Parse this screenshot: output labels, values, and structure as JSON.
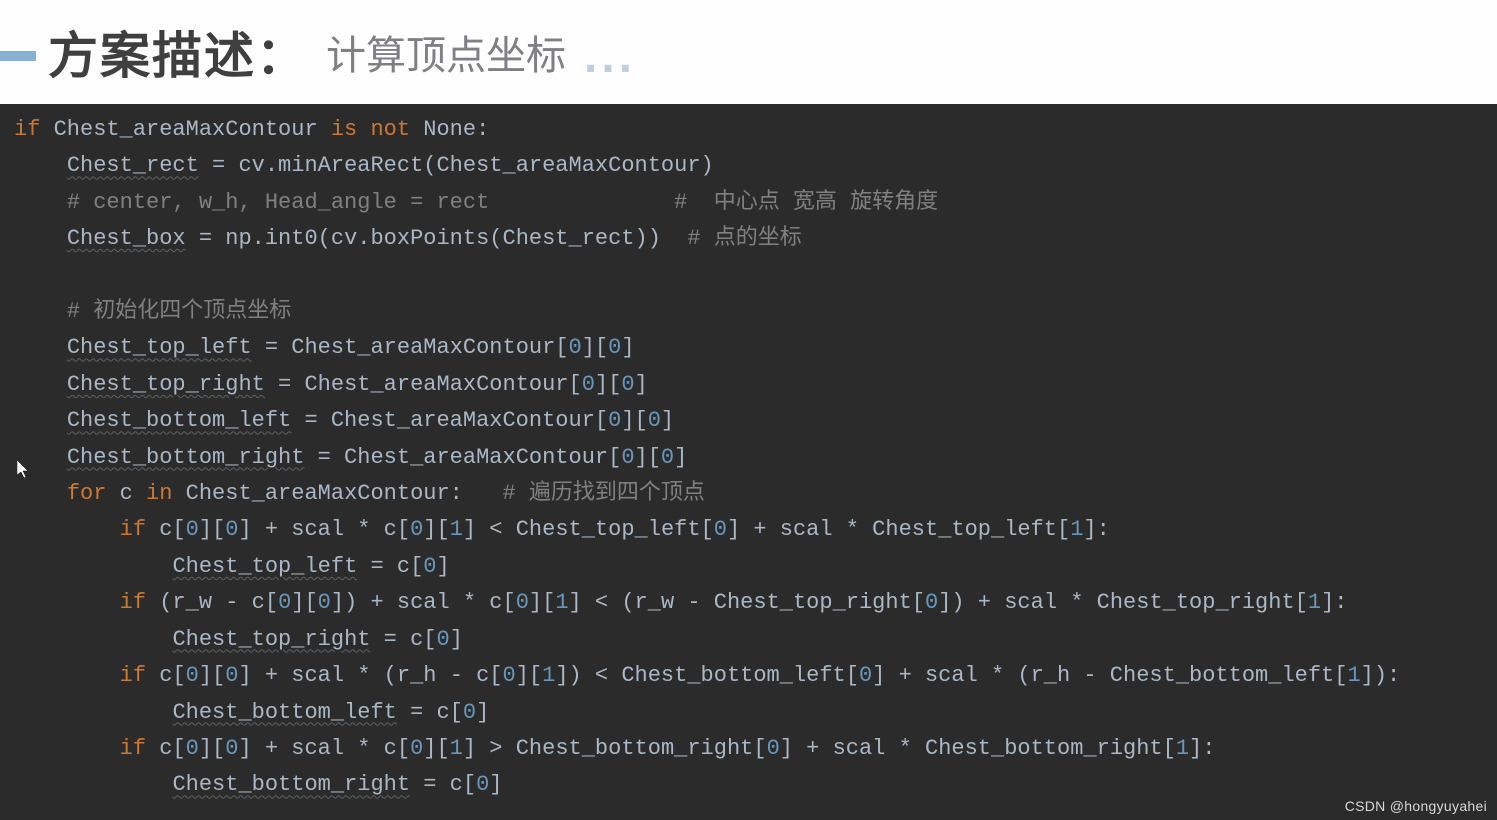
{
  "header": {
    "title_main": "方案描述：",
    "title_sub": "计算顶点坐标",
    "dots": "..."
  },
  "code": {
    "l1_kw1": "if",
    "l1_mid": " Chest_areaMaxContour ",
    "l1_kw2": "is not",
    "l1_end": " None:",
    "l2_var": "Chest_rect",
    "l2_rest": " = cv.minAreaRect(Chest_areaMaxContour)",
    "l3_cmt1": "# center, w_h, Head_angle = rect",
    "l3_cmt2": "#  中心点 宽高 旋转角度",
    "l4_var": "Chest_box",
    "l4_rest": " = np.int0(cv.boxPoints(Chest_rect))  ",
    "l4_cmt": "# 点的坐标",
    "l5_cmt": "# 初始化四个顶点坐标",
    "l6_var": "Chest_top_left",
    "l6_mid": " = Chest_areaMaxContour[",
    "l6_n0": "0",
    "l6_b1": "][",
    "l6_n1": "0",
    "l6_b2": "]",
    "l7_var": "Chest_top_right",
    "l7_mid": " = Chest_areaMaxContour[",
    "l7_n0": "0",
    "l7_b1": "][",
    "l7_n1": "0",
    "l7_b2": "]",
    "l8_var": "Chest_bottom_left",
    "l8_mid": " = Chest_areaMaxContour[",
    "l8_n0": "0",
    "l8_b1": "][",
    "l8_n1": "0",
    "l8_b2": "]",
    "l9_var": "Chest_bottom_right",
    "l9_mid": " = Chest_areaMaxContour[",
    "l9_n0": "0",
    "l9_b1": "][",
    "l9_n1": "0",
    "l9_b2": "]",
    "l10_kw1": "for",
    "l10_mid1": " c ",
    "l10_kw2": "in",
    "l10_mid2": " Chest_areaMaxContour:   ",
    "l10_cmt": "# 遍历找到四个顶点",
    "l11_kw": "if",
    "l11_a": " c[",
    "l11_n0": "0",
    "l11_b": "][",
    "l11_n1": "0",
    "l11_c": "] + scal * c[",
    "l11_n2": "0",
    "l11_d": "][",
    "l11_n3": "1",
    "l11_e": "] < Chest_top_left[",
    "l11_n4": "0",
    "l11_f": "] + scal * Chest_top_left[",
    "l11_n5": "1",
    "l11_g": "]:",
    "l12_var": "Chest_top_left",
    "l12_rest": " = c[",
    "l12_n": "0",
    "l12_b": "]",
    "l13_kw": "if",
    "l13_a": " (r_w - c[",
    "l13_n0": "0",
    "l13_b": "][",
    "l13_n1": "0",
    "l13_c": "]) + scal * c[",
    "l13_n2": "0",
    "l13_d": "][",
    "l13_n3": "1",
    "l13_e": "] < (r_w - Chest_top_right[",
    "l13_n4": "0",
    "l13_f": "]) + scal * Chest_top_right[",
    "l13_n5": "1",
    "l13_g": "]:",
    "l14_var": "Chest_top_right",
    "l14_rest": " = c[",
    "l14_n": "0",
    "l14_b": "]",
    "l15_kw": "if",
    "l15_a": " c[",
    "l15_n0": "0",
    "l15_b": "][",
    "l15_n1": "0",
    "l15_c": "] + scal * (r_h - c[",
    "l15_n2": "0",
    "l15_d": "][",
    "l15_n3": "1",
    "l15_e": "]) < Chest_bottom_left[",
    "l15_n4": "0",
    "l15_f": "] + scal * (r_h - Chest_bottom_left[",
    "l15_n5": "1",
    "l15_g": "]):",
    "l16_var": "Chest_bottom_left",
    "l16_rest": " = c[",
    "l16_n": "0",
    "l16_b": "]",
    "l17_kw": "if",
    "l17_a": " c[",
    "l17_n0": "0",
    "l17_b": "][",
    "l17_n1": "0",
    "l17_c": "] + scal * c[",
    "l17_n2": "0",
    "l17_d": "][",
    "l17_n3": "1",
    "l17_e": "] > Chest_bottom_right[",
    "l17_n4": "0",
    "l17_f": "] + scal * Chest_bottom_right[",
    "l17_n5": "1",
    "l17_g": "]:",
    "l18_var": "Chest_bottom_right",
    "l18_rest": " = c[",
    "l18_n": "0",
    "l18_b": "]"
  },
  "watermark": "CSDN @hongyuyahei"
}
